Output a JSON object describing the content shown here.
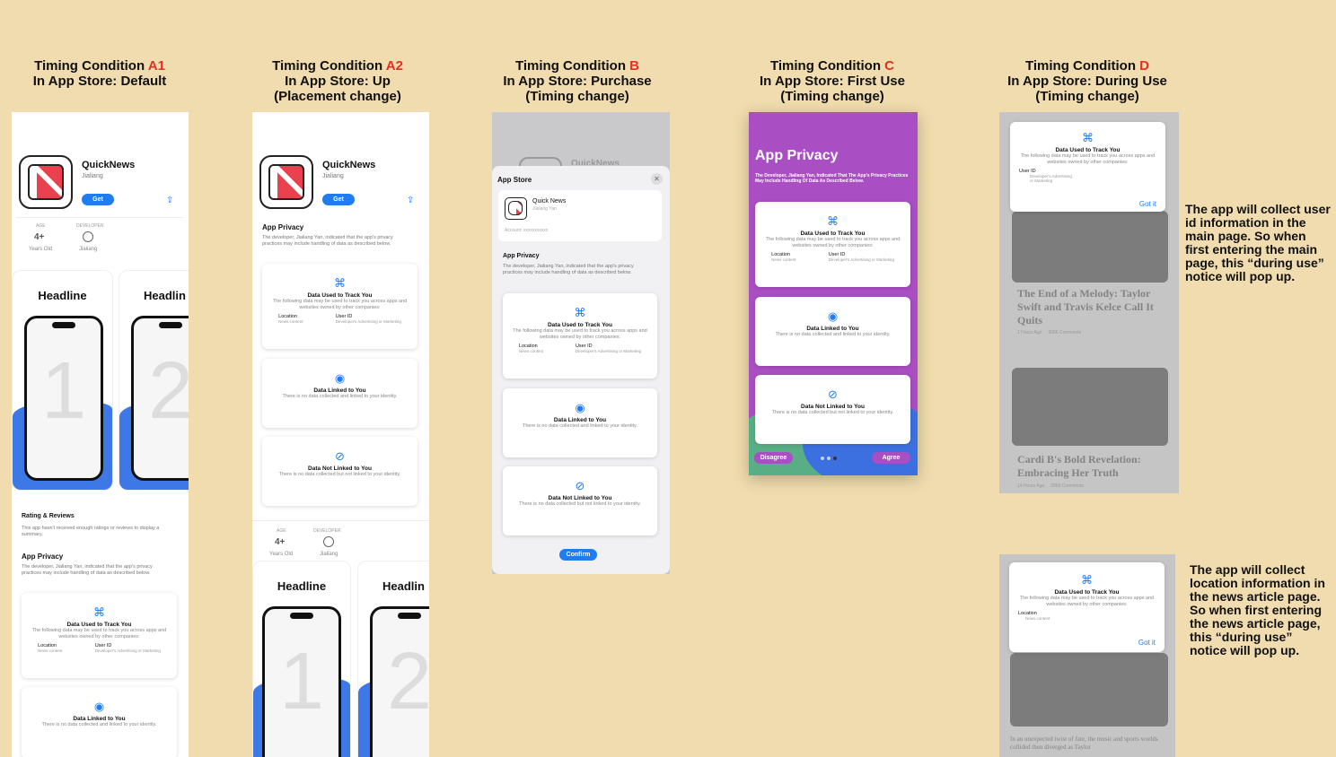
{
  "columns": [
    {
      "l1": "Timing Condition ",
      "code": "A1",
      "l2": "In App Store: Default",
      "l3": ""
    },
    {
      "l1": "Timing Condition ",
      "code": "A2",
      "l2": "In App Store: Up",
      "l3": "(Placement change)"
    },
    {
      "l1": "Timing Condition ",
      "code": "B",
      "l2": "In App Store: Purchase",
      "l3": "(Timing change)"
    },
    {
      "l1": "Timing Condition ",
      "code": "C",
      "l2": "In App Store: First Use",
      "l3": "(Timing change)"
    },
    {
      "l1": "Timing Condition ",
      "code": "D",
      "l2": "In App Store: During Use",
      "l3": "(Timing change)"
    }
  ],
  "app": {
    "name": "QuickNews",
    "developer": "Jialiang",
    "get": "Get",
    "age_label": "AGE",
    "age": "4+",
    "age_sub": "Years Old",
    "dev_label": "DEVELOPER",
    "dev_sub": "Jialiang"
  },
  "shots": {
    "h1": "Headline",
    "h2": "Headlin",
    "h2b": "Headlin",
    "n1": "1",
    "n2": "2"
  },
  "ratings": {
    "title": "Rating & Reviews",
    "text": "This app hasn't received enough ratings or reviews to display a summary."
  },
  "privacy": {
    "title": "App Privacy",
    "text": "The developer, Jialiang Yan, indicated that the app's privacy practices may include handling of data as described below.",
    "track_title": "Data Used to Track You",
    "track_desc": "The following data may be used to track you across apps and websites owned by other companies:",
    "loc": "Location",
    "loc_sub": "News content",
    "uid": "User ID",
    "uid_sub": "Developer's Advertising or Marketing",
    "linked_title": "Data Linked to You",
    "linked_desc": "There is no data collected and linked to your identity.",
    "notlinked_title": "Data Not Linked to You",
    "notlinked_desc": "There is no data collected but not linked to your identity."
  },
  "purchase": {
    "sheet_title": "App Store",
    "app_name": "Quick News",
    "dev": "Jialiang Yan",
    "account": "Account: xxxxxxxxxxx",
    "confirm": "Confirm",
    "bg_name": "QuickNews"
  },
  "firstuse": {
    "title": "App Privacy",
    "text": "The Developer, Jialiang Yan, Indicated That The App's Privacy Practices May Include Handling Of Data As Described Below.",
    "disagree": "Disagree",
    "agree": "Agree"
  },
  "duringuse": {
    "got": "Got it",
    "news1": "The End of a Melody: Taylor Swift and Travis Kelce Call It Quits",
    "news1_meta": "1 Hours Ago     3066 Comments",
    "news2": "Cardi B's Bold Revelation: Embracing Her Truth",
    "news2_meta": "14 Hours Ago     2066 Comments",
    "article": "In an unexpected twist of fate, the music and sports worlds collided then diverged as Taylor",
    "note1": "The app will collect user id information in the main page. So when first entering the main page, this “during use” notice will pop up.",
    "note2": "The app will collect location information in the news article page. So when first entering the news article page, this “during use” notice will pop up."
  },
  "colors": {
    "accent": "#1f7cf2",
    "code": "#e03023",
    "bg": "#f0dcae",
    "purple": "#a94ec3"
  }
}
